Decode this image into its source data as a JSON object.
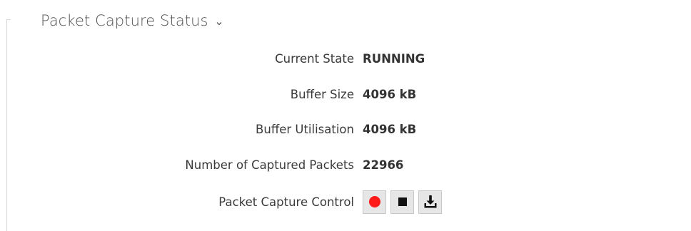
{
  "section": {
    "title": "Packet Capture Status"
  },
  "fields": [
    {
      "label": "Current State",
      "value": "RUNNING"
    },
    {
      "label": "Buffer Size",
      "value": "4096 kB"
    },
    {
      "label": "Buffer Utilisation",
      "value": "4096 kB"
    },
    {
      "label": "Number of Captured Packets",
      "value": "22966"
    }
  ],
  "control": {
    "label": "Packet Capture Control",
    "buttons": [
      {
        "icon": "record-icon",
        "color": "#ff1a1a"
      },
      {
        "icon": "stop-icon",
        "color": "#111111"
      },
      {
        "icon": "download-icon",
        "color": "#111111"
      }
    ]
  }
}
